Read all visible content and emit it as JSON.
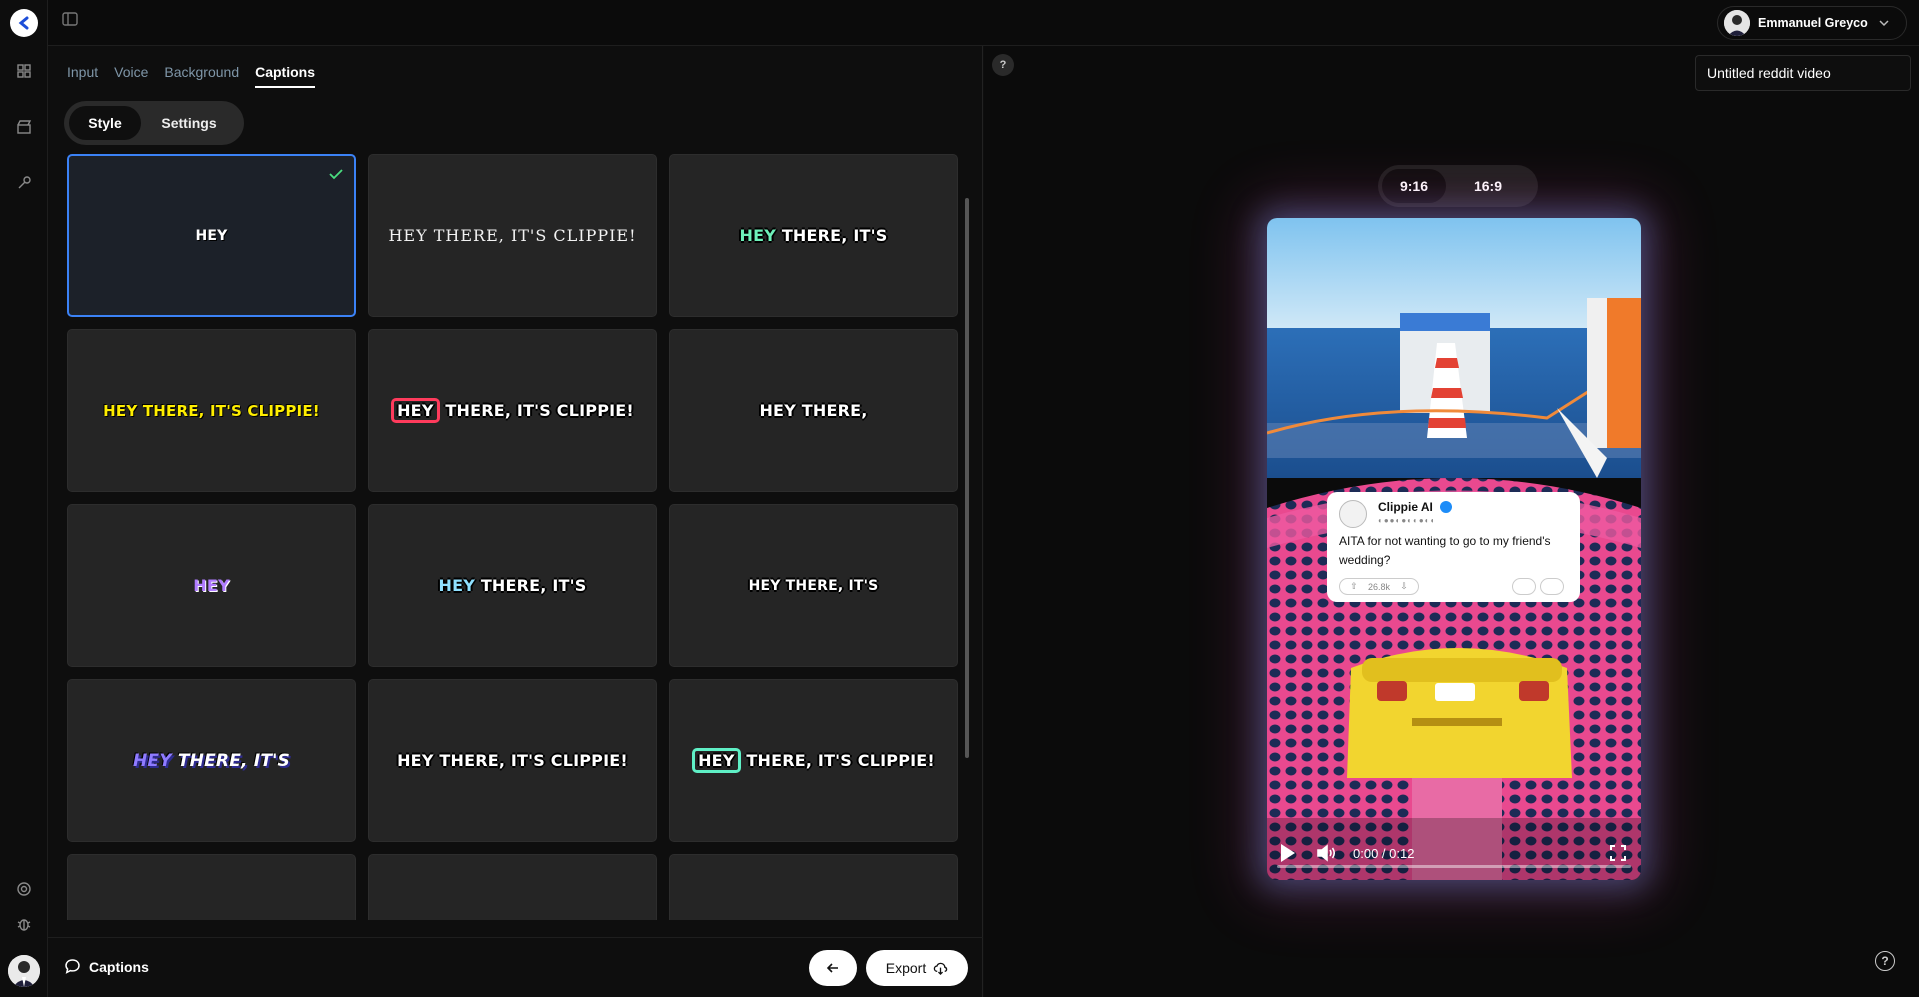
{
  "user": {
    "name": "Emmanuel Greyco"
  },
  "editor": {
    "tabs": [
      {
        "label": "Input",
        "active": false
      },
      {
        "label": "Voice",
        "active": false
      },
      {
        "label": "Background",
        "active": false
      },
      {
        "label": "Captions",
        "active": true
      }
    ],
    "segment": {
      "style": "Style",
      "settings": "Settings",
      "active": "Style"
    },
    "caption_styles": [
      {
        "text": "HEY",
        "style": "white-sm",
        "selected": true
      },
      {
        "text": "HEY THERE, IT'S CLIPPIE!",
        "style": "plain",
        "selected": false
      },
      {
        "highlight": "HEY",
        "rest": " THERE, IT'S",
        "style": "green-highlight",
        "selected": false
      },
      {
        "text": "HEY THERE, IT'S CLIPPIE!",
        "style": "yellow",
        "selected": false
      },
      {
        "highlight": "HEY",
        "rest": " THERE, IT'S CLIPPIE!",
        "style": "red-box",
        "selected": false
      },
      {
        "text": "HEY THERE,",
        "style": "outline",
        "selected": false
      },
      {
        "text": "HEY",
        "style": "purple",
        "selected": false
      },
      {
        "highlight": "HEY",
        "rest": " THERE, IT'S",
        "style": "blue-highlight",
        "selected": false
      },
      {
        "text": "HEY THERE, IT'S",
        "style": "outline",
        "selected": false
      },
      {
        "highlight": "HEY",
        "rest": " THERE, IT'S",
        "style": "italic-blue",
        "selected": false
      },
      {
        "text": "HEY THERE, IT'S CLIPPIE!",
        "style": "outline",
        "selected": false
      },
      {
        "highlight": "HEY",
        "rest": " THERE, IT'S CLIPPIE!",
        "style": "teal-box",
        "selected": false
      }
    ],
    "bottom": {
      "section_label": "Captions",
      "export_label": "Export"
    }
  },
  "preview": {
    "help": "?",
    "title_value": "Untitled reddit video",
    "ratios": [
      {
        "label": "9:16",
        "active": true
      },
      {
        "label": "16:9",
        "active": false
      }
    ],
    "post": {
      "author": "Clippie AI",
      "badges": "◐●●◐●◐◐●◐◐",
      "text": "AITA for not wanting to go to my friend's wedding?",
      "votes": "26.8k"
    },
    "player": {
      "time": "0:00 / 0:12",
      "progress": 0
    },
    "help_bottom": "?"
  },
  "colors": {
    "accent": "#3b82f6",
    "check": "#4ade80",
    "yellow": "#ffee00",
    "red": "#ff3b5c",
    "teal": "#5ff0c6"
  }
}
